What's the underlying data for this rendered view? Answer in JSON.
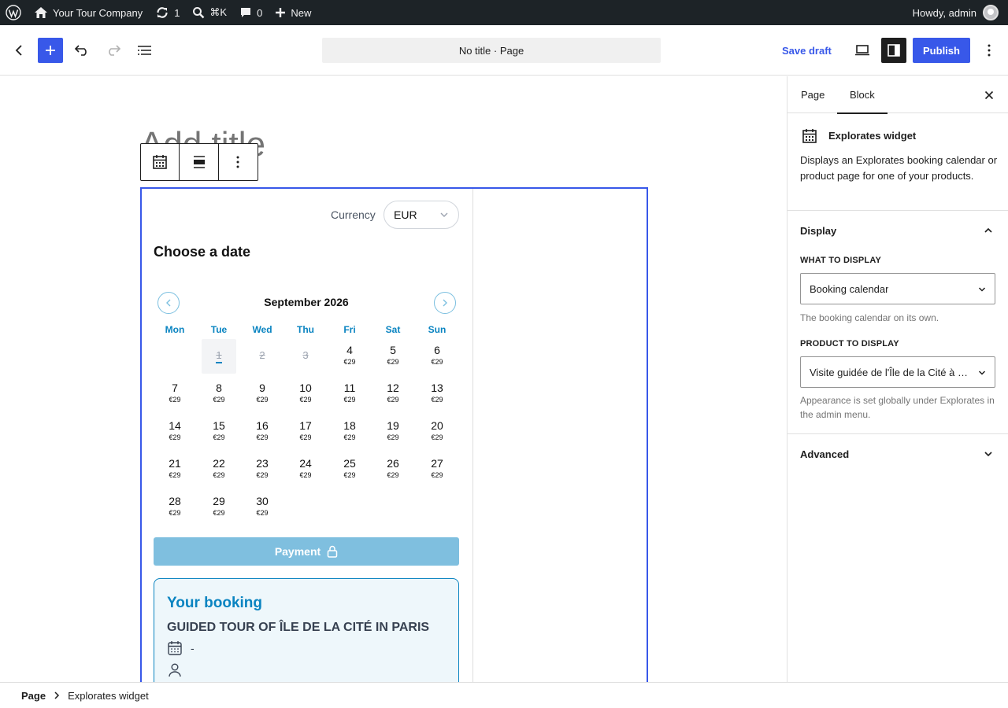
{
  "admin_bar": {
    "site_name": "Your Tour Company",
    "updates_count": "1",
    "search_shortcut": "⌘K",
    "comments_count": "0",
    "new_label": "New",
    "greeting": "Howdy, admin"
  },
  "header": {
    "document_title": "No title · Page",
    "save_draft_label": "Save draft",
    "publish_label": "Publish"
  },
  "canvas": {
    "title_placeholder": "Add title"
  },
  "widget": {
    "currency_label": "Currency",
    "currency_value": "EUR",
    "choose_date_heading": "Choose a date",
    "month_label": "September 2026",
    "weekdays": [
      "Mon",
      "Tue",
      "Wed",
      "Thu",
      "Fri",
      "Sat",
      "Sun"
    ],
    "days": [
      {
        "n": "1",
        "price": "",
        "state": "today"
      },
      {
        "n": "2",
        "price": "",
        "state": "muted"
      },
      {
        "n": "3",
        "price": "",
        "state": "muted"
      },
      {
        "n": "4",
        "price": "€29",
        "state": "available"
      },
      {
        "n": "5",
        "price": "€29",
        "state": "available"
      },
      {
        "n": "6",
        "price": "€29",
        "state": "available"
      },
      {
        "n": "7",
        "price": "€29",
        "state": "available"
      },
      {
        "n": "8",
        "price": "€29",
        "state": "available"
      },
      {
        "n": "9",
        "price": "€29",
        "state": "available"
      },
      {
        "n": "10",
        "price": "€29",
        "state": "available"
      },
      {
        "n": "11",
        "price": "€29",
        "state": "available"
      },
      {
        "n": "12",
        "price": "€29",
        "state": "available"
      },
      {
        "n": "13",
        "price": "€29",
        "state": "available"
      },
      {
        "n": "14",
        "price": "€29",
        "state": "available"
      },
      {
        "n": "15",
        "price": "€29",
        "state": "available"
      },
      {
        "n": "16",
        "price": "€29",
        "state": "available"
      },
      {
        "n": "17",
        "price": "€29",
        "state": "available"
      },
      {
        "n": "18",
        "price": "€29",
        "state": "available"
      },
      {
        "n": "19",
        "price": "€29",
        "state": "available"
      },
      {
        "n": "20",
        "price": "€29",
        "state": "available"
      },
      {
        "n": "21",
        "price": "€29",
        "state": "available"
      },
      {
        "n": "22",
        "price": "€29",
        "state": "available"
      },
      {
        "n": "23",
        "price": "€29",
        "state": "available"
      },
      {
        "n": "24",
        "price": "€29",
        "state": "available"
      },
      {
        "n": "25",
        "price": "€29",
        "state": "available"
      },
      {
        "n": "26",
        "price": "€29",
        "state": "available"
      },
      {
        "n": "27",
        "price": "€29",
        "state": "available"
      },
      {
        "n": "28",
        "price": "€29",
        "state": "available"
      },
      {
        "n": "29",
        "price": "€29",
        "state": "available"
      },
      {
        "n": "30",
        "price": "€29",
        "state": "available"
      }
    ],
    "first_weekday_offset": 1,
    "payment_label": "Payment",
    "booking_title": "Your booking",
    "booking_product": "GUIDED TOUR OF ÎLE DE LA CITÉ IN PARIS",
    "booking_date_value": "-"
  },
  "sidebar": {
    "tabs": [
      {
        "label": "Page",
        "active": false
      },
      {
        "label": "Block",
        "active": true
      }
    ],
    "block_name": "Explorates widget",
    "block_description": "Displays an Explorates booking calendar or product page for one of your products.",
    "display_panel": {
      "title": "Display",
      "what_label": "What to display",
      "what_value": "Booking calendar",
      "what_help": "The booking calendar on its own.",
      "product_label": "Product to display",
      "product_value": "Visite guidée de l'Île de la Cité à Paris",
      "product_help": "Appearance is set globally under Explorates in the admin menu."
    },
    "advanced_panel": {
      "title": "Advanced"
    }
  },
  "footer": {
    "breadcrumb_root": "Page",
    "breadcrumb_item": "Explorates widget"
  },
  "colors": {
    "accent": "#3858e9",
    "widget_blue": "#0a84c1",
    "payment_disabled": "#7fbfdf"
  }
}
